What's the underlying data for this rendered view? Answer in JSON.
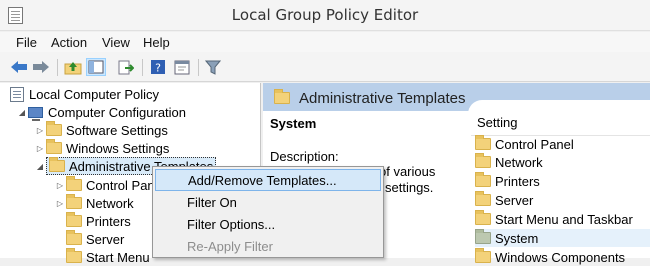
{
  "window": {
    "title": "Local Group Policy Editor"
  },
  "menubar": {
    "items": [
      "File",
      "Action",
      "View",
      "Help"
    ]
  },
  "toolbar": {
    "buttons": [
      "back-arrow-icon",
      "forward-arrow-icon",
      "up-folder-icon",
      "show-hide-console-tree-icon",
      "export-list-icon",
      "help-icon",
      "properties-icon",
      "filter-icon"
    ]
  },
  "tree": {
    "root": "Local Computer Policy",
    "computer_configuration": "Computer Configuration",
    "software_settings": "Software Settings",
    "windows_settings": "Windows Settings",
    "administrative_templates": "Administrative Templates",
    "children": [
      "Control Panel",
      "Network",
      "Printers",
      "Server",
      "Start Menu"
    ]
  },
  "details": {
    "header": "Administrative Templates",
    "selected_title": "System",
    "description_label": "Description:",
    "description_line1": "of various",
    "description_line2": "settings.",
    "column_header": "Setting",
    "settings": [
      "Control Panel",
      "Network",
      "Printers",
      "Server",
      "Start Menu and Taskbar",
      "System",
      "Windows Components"
    ]
  },
  "context_menu": {
    "items": [
      {
        "label": "Add/Remove Templates...",
        "state": "highlighted"
      },
      {
        "label": "Filter On",
        "state": "normal"
      },
      {
        "label": "Filter Options...",
        "state": "normal"
      },
      {
        "label": "Re-Apply Filter",
        "state": "disabled"
      }
    ]
  },
  "colors": {
    "header_band": "#b9cfe9",
    "selection": "#d9ebf9",
    "menu_highlight": "#d5e8f9",
    "folder": "#f3d27a"
  }
}
